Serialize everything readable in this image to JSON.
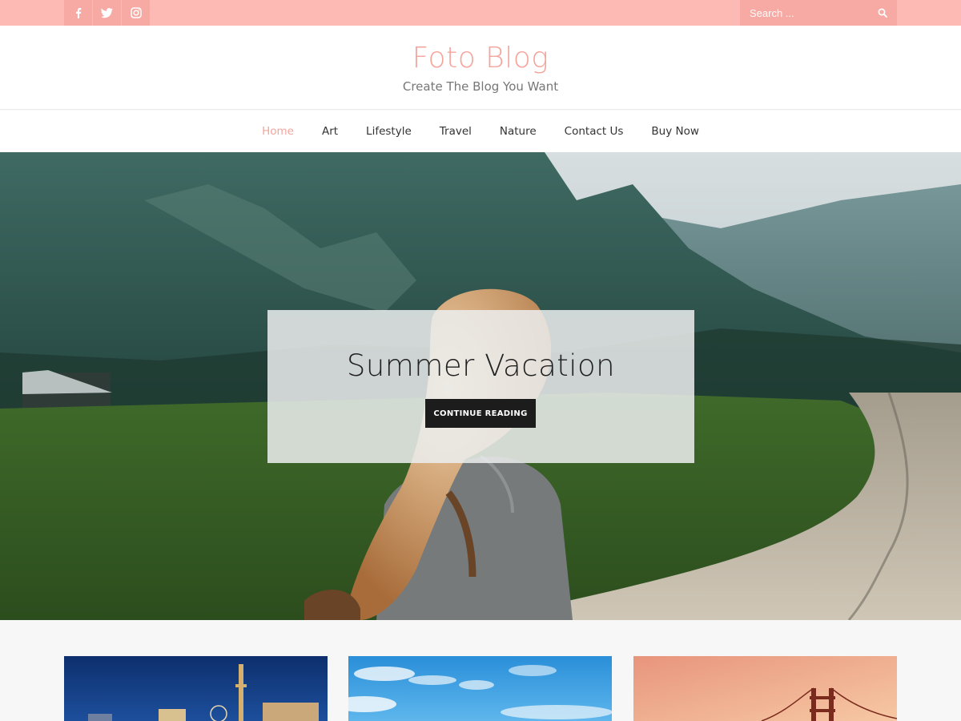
{
  "topbar": {
    "social": [
      {
        "name": "facebook-icon"
      },
      {
        "name": "twitter-icon"
      },
      {
        "name": "instagram-icon"
      }
    ],
    "search_placeholder": "Search ...",
    "search_icon": "search-icon",
    "color": "#fdb9b4"
  },
  "header": {
    "title": "Foto Blog",
    "tagline": "Create The Blog You Want",
    "title_color": "#f5a49c"
  },
  "nav": {
    "items": [
      {
        "label": "Home",
        "active": true
      },
      {
        "label": "Art"
      },
      {
        "label": "Lifestyle"
      },
      {
        "label": "Travel"
      },
      {
        "label": "Nature"
      },
      {
        "label": "Contact Us"
      },
      {
        "label": "Buy Now"
      }
    ]
  },
  "hero": {
    "title": "Summer Vacation",
    "button_label": "CONTINUE READING"
  },
  "posts": [
    {
      "image": "city-night-skyline-thumbnail"
    },
    {
      "image": "blue-sky-clouds-thumbnail"
    },
    {
      "image": "sunset-bridge-thumbnail"
    }
  ]
}
